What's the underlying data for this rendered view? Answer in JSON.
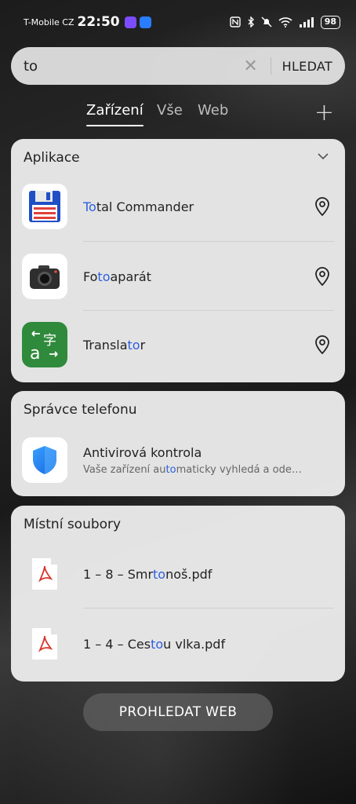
{
  "status_bar": {
    "carrier": "T-Mobile CZ",
    "time": "22:50",
    "battery": "98",
    "app_badge_colors": [
      "#7b4dff",
      "#2a7dff"
    ]
  },
  "search": {
    "query": "to",
    "submit_label": "HLEDAT"
  },
  "tabs": [
    {
      "label": "Zařízení",
      "active": true
    },
    {
      "label": "Vše",
      "active": false
    },
    {
      "label": "Web",
      "active": false
    }
  ],
  "apps_section": {
    "title": "Aplikace",
    "items": [
      {
        "pre": "",
        "match": "To",
        "post": "tal Commander",
        "icon": "floppy-disk-icon"
      },
      {
        "pre": "Fo",
        "match": "to",
        "post": "aparát",
        "icon": "camera-icon"
      },
      {
        "pre": "Transla",
        "match": "to",
        "post": "r",
        "icon": "translate-icon"
      }
    ]
  },
  "phone_manager_section": {
    "title": "Správce telefonu",
    "item": {
      "label": "Antivirová kontrola",
      "sub_pre": "Vaše zařízení au",
      "sub_match": "to",
      "sub_post": "maticky vyhledá a ode…",
      "icon": "shield-icon"
    }
  },
  "files_section": {
    "title": "Místní soubory",
    "items": [
      {
        "pre": "1 – 8 – Smr",
        "match": "to",
        "post": "noš.pdf",
        "icon": "pdf-icon"
      },
      {
        "pre": "1 – 4 – Ces",
        "match": "to",
        "post": "u vlka.pdf",
        "icon": "pdf-icon"
      }
    ]
  },
  "web_button": "PROHLEDAT WEB",
  "colors": {
    "highlight": "#2c5fe0",
    "card_bg": "#ebebeb"
  }
}
